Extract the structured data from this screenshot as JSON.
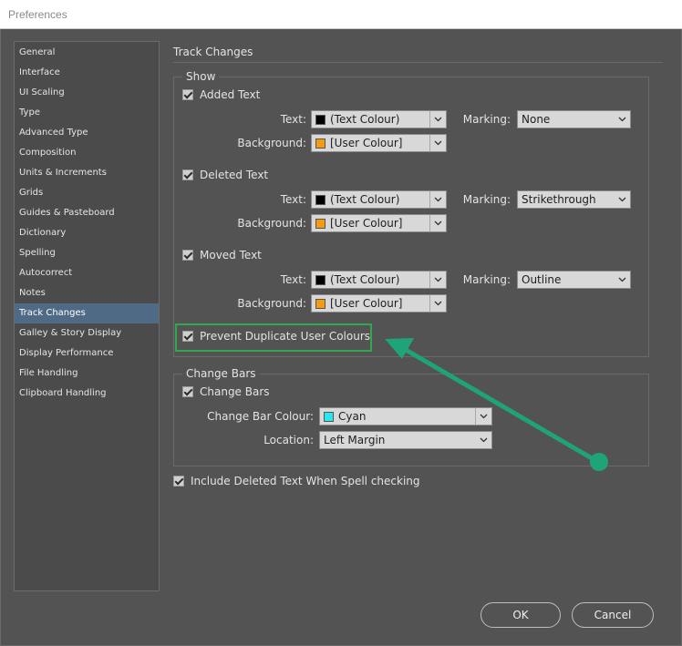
{
  "window": {
    "title": "Preferences"
  },
  "sidebar": {
    "items": [
      {
        "label": "General"
      },
      {
        "label": "Interface"
      },
      {
        "label": "UI Scaling"
      },
      {
        "label": "Type"
      },
      {
        "label": "Advanced Type"
      },
      {
        "label": "Composition"
      },
      {
        "label": "Units & Increments"
      },
      {
        "label": "Grids"
      },
      {
        "label": "Guides & Pasteboard"
      },
      {
        "label": "Dictionary"
      },
      {
        "label": "Spelling"
      },
      {
        "label": "Autocorrect"
      },
      {
        "label": "Notes"
      },
      {
        "label": "Track Changes",
        "selected": true
      },
      {
        "label": "Galley & Story Display"
      },
      {
        "label": "Display Performance"
      },
      {
        "label": "File Handling"
      },
      {
        "label": "Clipboard Handling"
      }
    ]
  },
  "panel": {
    "title": "Track Changes",
    "show": {
      "group_label": "Show",
      "text_label": "Text:",
      "background_label": "Background:",
      "marking_label": "Marking:",
      "entries": [
        {
          "label": "Added Text",
          "checked": true,
          "text_value": "(Text Colour)",
          "text_color": "#000000",
          "background_value": "[User Colour]",
          "background_color": "#f39c12",
          "marking_value": "None"
        },
        {
          "label": "Deleted Text",
          "checked": true,
          "text_value": "(Text Colour)",
          "text_color": "#000000",
          "background_value": "[User Colour]",
          "background_color": "#f39c12",
          "marking_value": "Strikethrough"
        },
        {
          "label": "Moved Text",
          "checked": true,
          "text_value": "(Text Colour)",
          "text_color": "#000000",
          "background_value": "[User Colour]",
          "background_color": "#f39c12",
          "marking_value": "Outline"
        }
      ],
      "prevent_duplicate": {
        "label": "Prevent Duplicate User Colours",
        "checked": true
      }
    },
    "change_bars": {
      "group_label": "Change Bars",
      "checkbox": {
        "label": "Change Bars",
        "checked": true
      },
      "colour_label": "Change Bar Colour:",
      "colour_value": "Cyan",
      "colour_swatch": "#29e6f0",
      "location_label": "Location:",
      "location_value": "Left Margin"
    },
    "include_deleted": {
      "label": "Include Deleted Text When Spell checking",
      "checked": true
    }
  },
  "buttons": {
    "ok": "OK",
    "cancel": "Cancel"
  },
  "annotation": {
    "highlight_color": "#2fa84f",
    "arrow_color": "#1fa378",
    "arrow_icon": "annotation-arrow-icon"
  }
}
